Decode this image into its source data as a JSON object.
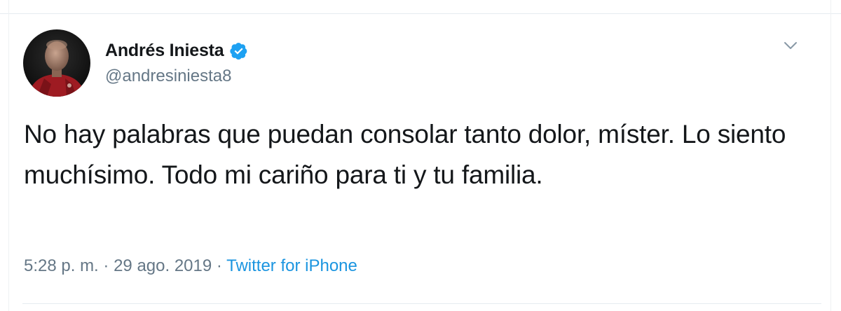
{
  "tweet": {
    "author": {
      "display_name": "Andrés Iniesta",
      "handle": "@andresiniesta8",
      "verified": true,
      "avatar_icon": "profile-photo"
    },
    "text": "No hay palabras que puedan consolar tanto dolor, míster. Lo siento muchísimo. Todo mi cariño para ti y tu familia.",
    "time": "5:28 p. m.",
    "separator": "·",
    "date": "29 ago. 2019",
    "source": "Twitter for iPhone",
    "menu_icon": "chevron-down-icon"
  },
  "colors": {
    "text_primary": "#14171a",
    "text_secondary": "#657786",
    "link": "#1b95e0",
    "verified_badge": "#1da1f2",
    "divider": "#e6ecf0"
  }
}
